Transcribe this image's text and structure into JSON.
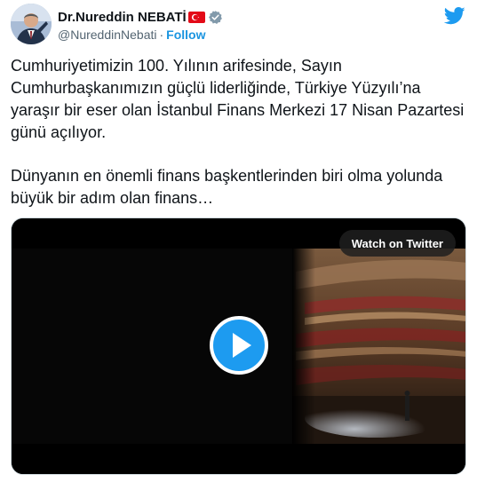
{
  "author": {
    "display_name": "Dr.Nureddin NEBATİ",
    "handle": "@NureddinNebati",
    "separator": "·",
    "follow_label": "Follow",
    "flag_icon": "turkey-flag-icon",
    "verified_icon": "verified-badge-icon"
  },
  "tweet": {
    "paragraph_1": "Cumhuriyetimizin 100. Yılının arifesinde, Sayın Cumhurbaşkanımızın güçlü liderliğinde, Türkiye Yüzyılı’na yaraşır bir eser olan İstanbul Finans Merkezi 17 Nisan Pazartesi günü açılıyor.",
    "paragraph_2": "Dünyanın en önemli finans başkentlerinden biri olma yolunda büyük bir adım olan finans…"
  },
  "media": {
    "watch_label": "Watch on Twitter",
    "play_icon": "play-icon"
  },
  "colors": {
    "twitter_blue": "#1d9bf0",
    "follow_blue": "#1b95e0",
    "text": "#0f1419",
    "muted": "#536471"
  }
}
